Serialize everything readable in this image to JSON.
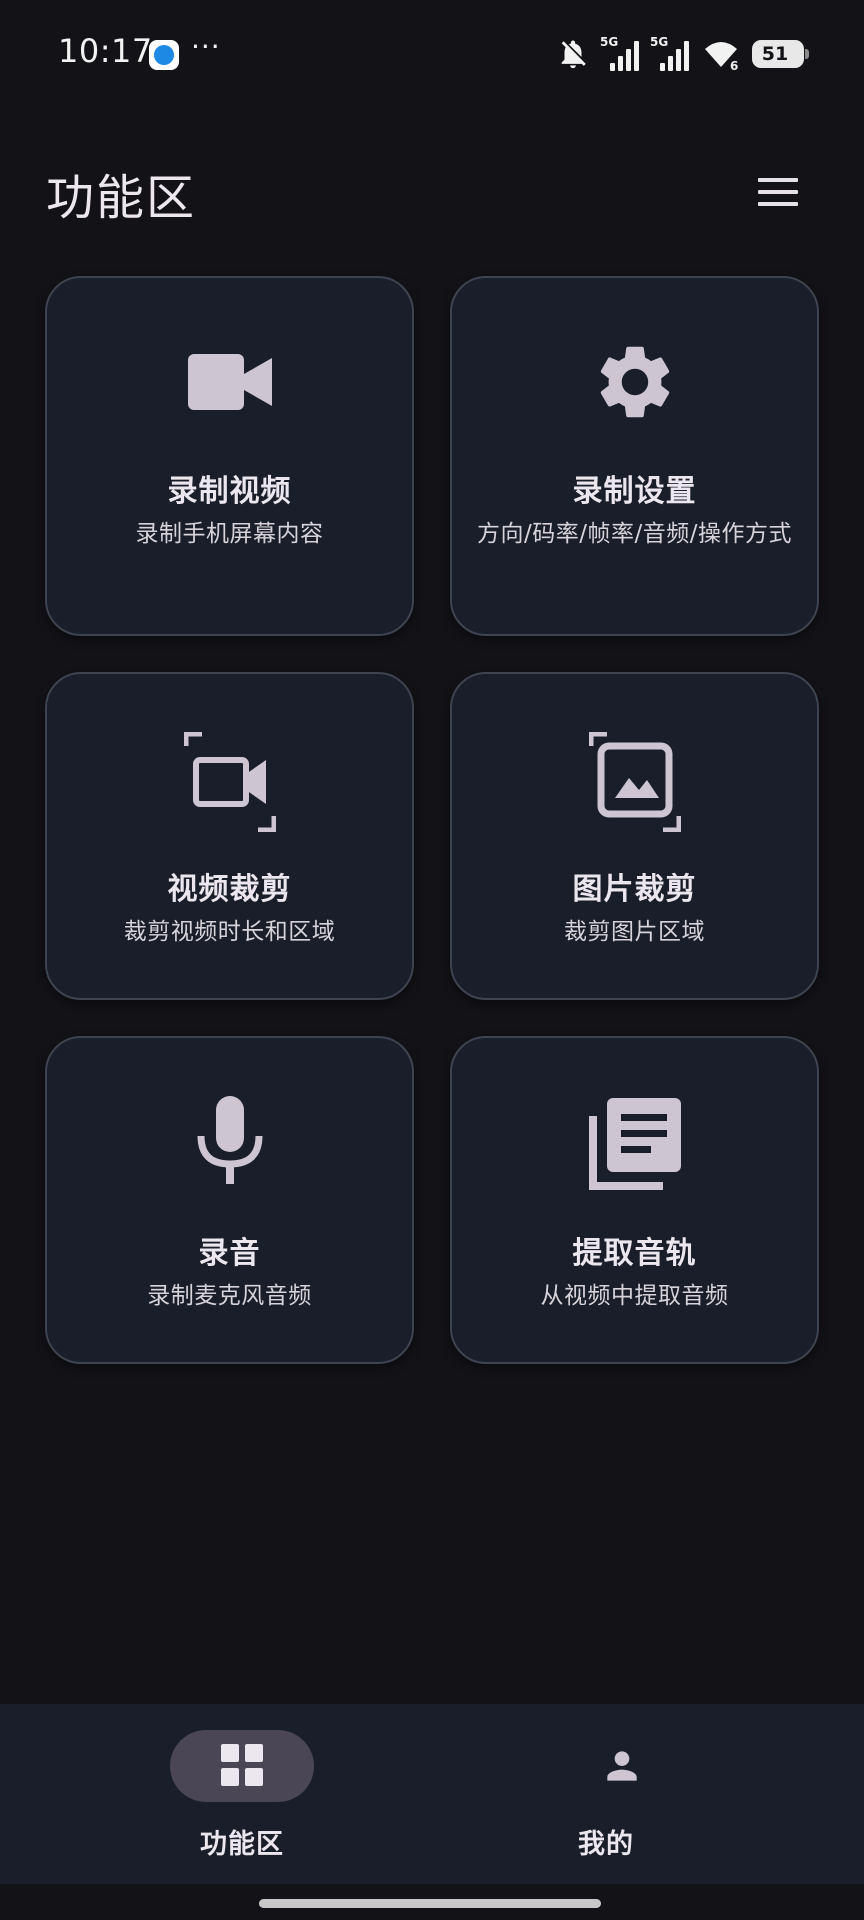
{
  "status_bar": {
    "time": "10:17",
    "more": "···",
    "network_1": "5G",
    "network_2": "5G",
    "wifi_level": "6",
    "battery": "51",
    "icons": [
      "app-notification-icon",
      "bell-off-icon",
      "signal-icon",
      "signal-icon",
      "wifi-icon",
      "battery-icon"
    ]
  },
  "header": {
    "title": "功能区",
    "menu_icon": "hamburger-menu-icon"
  },
  "cards": [
    {
      "title": "录制视频",
      "subtitle": "录制手机屏幕内容",
      "icon": "videocam-icon"
    },
    {
      "title": "录制设置",
      "subtitle": "方向/码率/帧率/音频/操作方式",
      "icon": "gear-icon"
    },
    {
      "title": "视频裁剪",
      "subtitle": "裁剪视频时长和区域",
      "icon": "video-crop-icon"
    },
    {
      "title": "图片裁剪",
      "subtitle": "裁剪图片区域",
      "icon": "image-crop-icon"
    },
    {
      "title": "录音",
      "subtitle": "录制麦克风音频",
      "icon": "microphone-icon"
    },
    {
      "title": "提取音轨",
      "subtitle": "从视频中提取音频",
      "icon": "library-books-icon"
    }
  ],
  "bottom_nav": {
    "items": [
      {
        "label": "功能区",
        "icon": "grid-icon",
        "selected": true
      },
      {
        "label": "我的",
        "icon": "person-icon",
        "selected": false
      }
    ]
  },
  "colors": {
    "background": "#131217",
    "card": "#191e2a",
    "card_border": "#3e4350",
    "icon": "#cdc5d2",
    "nav_pill": "#4a4655"
  }
}
